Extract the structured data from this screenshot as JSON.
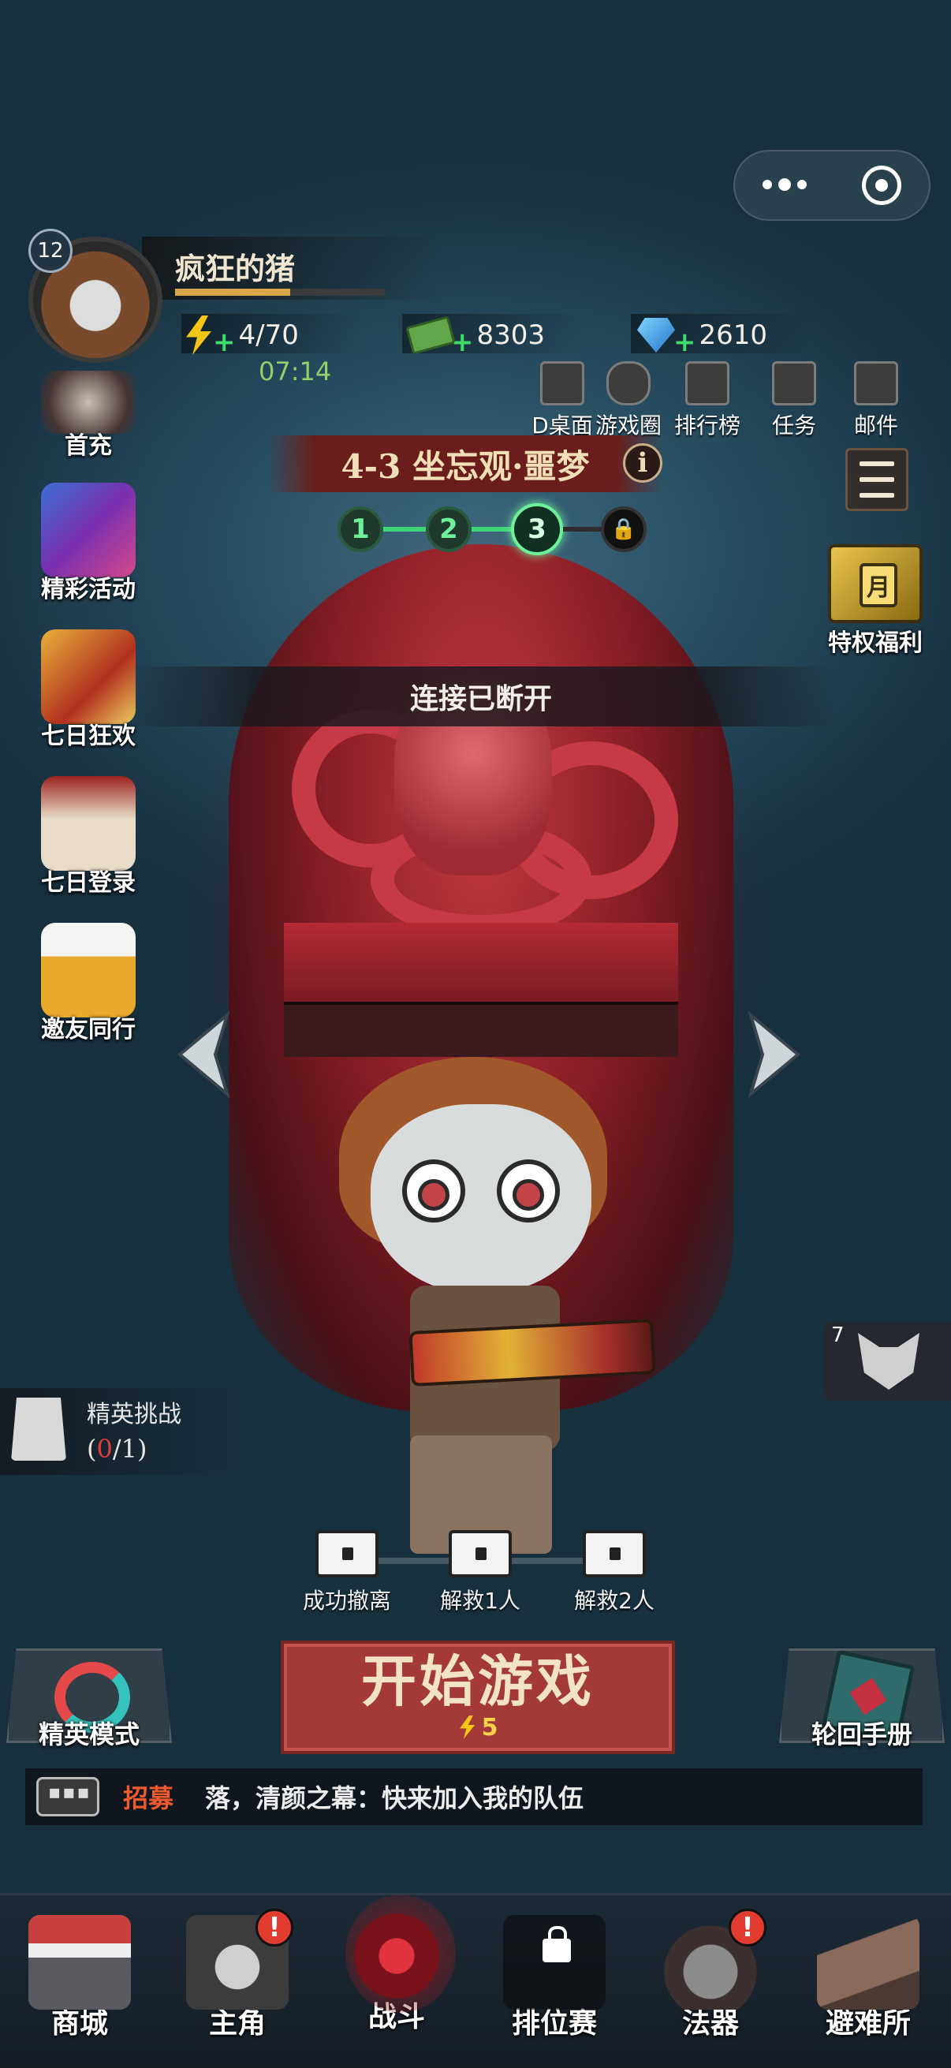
{
  "player": {
    "name": "疯狂的猪",
    "level": "12",
    "xp_fraction": 0.55
  },
  "resources": {
    "stamina": "4/70",
    "stamina_timer": "07:14",
    "cash": "8303",
    "gems": "2610",
    "plus": "+"
  },
  "top_menu": [
    {
      "label": "D桌面",
      "icon": "desktop-icon"
    },
    {
      "label": "游戏圈",
      "icon": "gamepad-icon"
    },
    {
      "label": "排行榜",
      "icon": "ranking-icon"
    },
    {
      "label": "任务",
      "icon": "task-icon"
    },
    {
      "label": "邮件",
      "icon": "mail-icon"
    }
  ],
  "left_menu": [
    {
      "label": "首充",
      "icon": "first-charge-icon"
    },
    {
      "label": "精彩活动",
      "icon": "gift-stars-icon"
    },
    {
      "label": "七日狂欢",
      "icon": "seven-carnival-icon"
    },
    {
      "label": "七日登录",
      "icon": "calendar-seven-icon"
    },
    {
      "label": "邀友同行",
      "icon": "beer-mugs-icon"
    }
  ],
  "stage": {
    "title": "4-3 坐忘观·噩梦",
    "info": "i",
    "nodes": [
      "1",
      "2",
      "3"
    ],
    "current_node": 3
  },
  "privilege": {
    "label": "特权福利",
    "badge": "月"
  },
  "toast": "连接已断开",
  "elite_challenge": {
    "title": "精英挑战",
    "count_open": "(",
    "count_done": "0",
    "count_total": "/1)"
  },
  "side_badge": {
    "count": "7"
  },
  "chests": [
    {
      "label": "成功撤离"
    },
    {
      "label": "解救1人"
    },
    {
      "label": "解救2人"
    }
  ],
  "buttons": {
    "start": "开始游戏",
    "start_cost": "5",
    "elite_mode": "精英模式",
    "reincarnation_manual": "轮回手册"
  },
  "recruit": {
    "tag": "招募",
    "message": "落，清颜之幕：快来加入我的队伍"
  },
  "bottom_nav": [
    {
      "label": "商城",
      "alert": ""
    },
    {
      "label": "主角",
      "alert": "!"
    },
    {
      "label": "战斗",
      "alert": ""
    },
    {
      "label": "排位赛",
      "alert": ""
    },
    {
      "label": "法器",
      "alert": "!"
    },
    {
      "label": "避难所",
      "alert": ""
    }
  ],
  "colors": {
    "accent_red": "#a33a37",
    "stamina_green": "#3fdc6a",
    "node_green": "#6ef09a",
    "recruit_orange": "#ee5a2e"
  }
}
